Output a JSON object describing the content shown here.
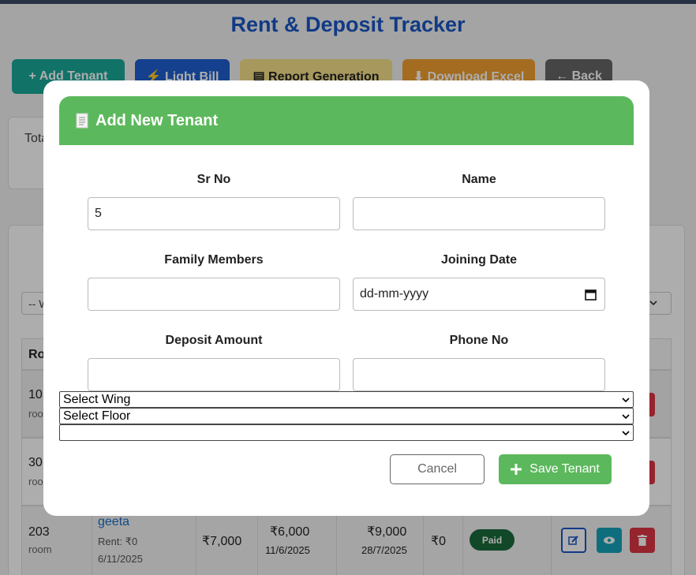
{
  "page": {
    "title": "Rent & Deposit Tracker"
  },
  "toolbar": {
    "add_tenant": "+ Add Tenant",
    "light_bill": "⚡ Light Bill",
    "report": "▤ Report Generation",
    "download_excel": "⬇ Download Excel",
    "back": "← Back"
  },
  "summary": {
    "label": "Tota"
  },
  "filters": {
    "wing_placeholder": "-- W"
  },
  "table": {
    "header_room": "Ro",
    "rows": [
      {
        "room": "10",
        "type": "room"
      },
      {
        "room": "30",
        "type": "roo"
      },
      {
        "room": "203",
        "type": "room",
        "tenant": "geeta",
        "rent_note": "Rent: ₹0",
        "date": "6/11/2025",
        "rent": "₹7,000",
        "amount_a": "₹6,000",
        "date_a": "11/6/2025",
        "amount_b": "₹9,000",
        "date_b": "28/7/2025",
        "due": "₹0",
        "status": "Paid"
      }
    ]
  },
  "modal": {
    "title": "Add New Tenant",
    "icon": "receipt-icon",
    "fields": {
      "sr_no": {
        "label": "Sr No",
        "value": "5"
      },
      "name": {
        "label": "Name",
        "value": ""
      },
      "family": {
        "label": "Family Members",
        "value": ""
      },
      "joining": {
        "label": "Joining Date",
        "placeholder": "dd-mm-yyyy"
      },
      "deposit": {
        "label": "Deposit Amount",
        "value": ""
      },
      "phone": {
        "label": "Phone No",
        "value": ""
      }
    },
    "selects": {
      "wing": "Select Wing",
      "floor": "Select Floor",
      "room": ""
    },
    "cancel": "Cancel",
    "save": "Save Tenant"
  },
  "colors": {
    "accent_green": "#5cb85c",
    "title_blue": "#1a56c4",
    "paid_badge": "#1a6b3c"
  }
}
